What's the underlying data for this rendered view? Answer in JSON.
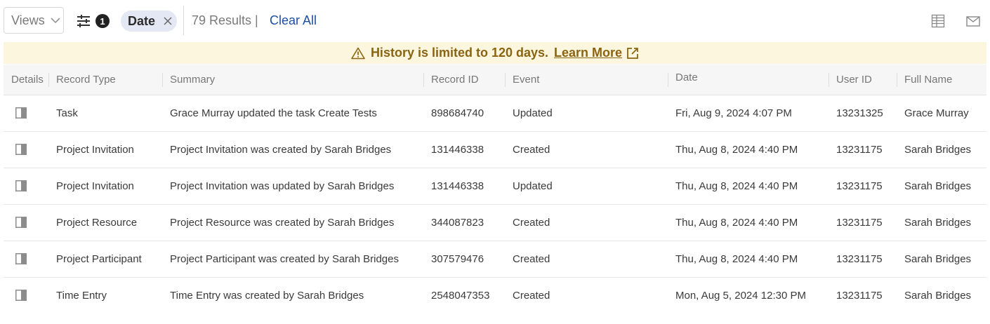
{
  "toolbar": {
    "views_label": "Views",
    "views_icon": "chevron-down-icon",
    "filter_icon": "sliders-icon",
    "filter_count": "1",
    "chip_label": "Date",
    "chip_close_icon": "close-icon",
    "results_text": "79 Results |",
    "clear_all_label": "Clear All",
    "columns_icon": "column-settings-icon",
    "email_icon": "envelope-icon"
  },
  "banner": {
    "icon": "warning-icon",
    "message": "History is limited to 120 days.",
    "link_label": "Learn More",
    "link_icon": "external-link-icon",
    "text_color": "#8a6411",
    "background": "#fdf6df"
  },
  "table": {
    "columns": [
      "Details",
      "Record Type",
      "Summary",
      "Record ID",
      "Event",
      "Date",
      "User ID",
      "Full Name"
    ],
    "rows": [
      {
        "record_type": "Task",
        "summary": "Grace Murray updated the task Create Tests",
        "record_id": "898684740",
        "event": "Updated",
        "date": "Fri, Aug 9, 2024 4:07 PM",
        "user_id": "13231325",
        "full_name": "Grace Murray"
      },
      {
        "record_type": "Project Invitation",
        "summary": "Project Invitation was created by Sarah Bridges",
        "record_id": "131446338",
        "event": "Created",
        "date": "Thu, Aug 8, 2024 4:40 PM",
        "user_id": "13231175",
        "full_name": "Sarah Bridges"
      },
      {
        "record_type": "Project Invitation",
        "summary": "Project Invitation was updated by Sarah Bridges",
        "record_id": "131446338",
        "event": "Updated",
        "date": "Thu, Aug 8, 2024 4:40 PM",
        "user_id": "13231175",
        "full_name": "Sarah Bridges"
      },
      {
        "record_type": "Project Resource",
        "summary": "Project Resource was created by Sarah Bridges",
        "record_id": "344087823",
        "event": "Created",
        "date": "Thu, Aug 8, 2024 4:40 PM",
        "user_id": "13231175",
        "full_name": "Sarah Bridges"
      },
      {
        "record_type": "Project Participant",
        "summary": "Project Participant was created by Sarah Bridges",
        "record_id": "307579476",
        "event": "Created",
        "date": "Thu, Aug 8, 2024 4:40 PM",
        "user_id": "13231175",
        "full_name": "Sarah Bridges"
      },
      {
        "record_type": "Time Entry",
        "summary": "Time Entry was created by Sarah Bridges",
        "record_id": "2548047353",
        "event": "Created",
        "date": "Mon, Aug 5, 2024 12:30 PM",
        "user_id": "13231175",
        "full_name": "Sarah Bridges"
      }
    ]
  },
  "colors": {
    "link": "#1f4fa3",
    "chip_background": "#e4e8f4"
  }
}
